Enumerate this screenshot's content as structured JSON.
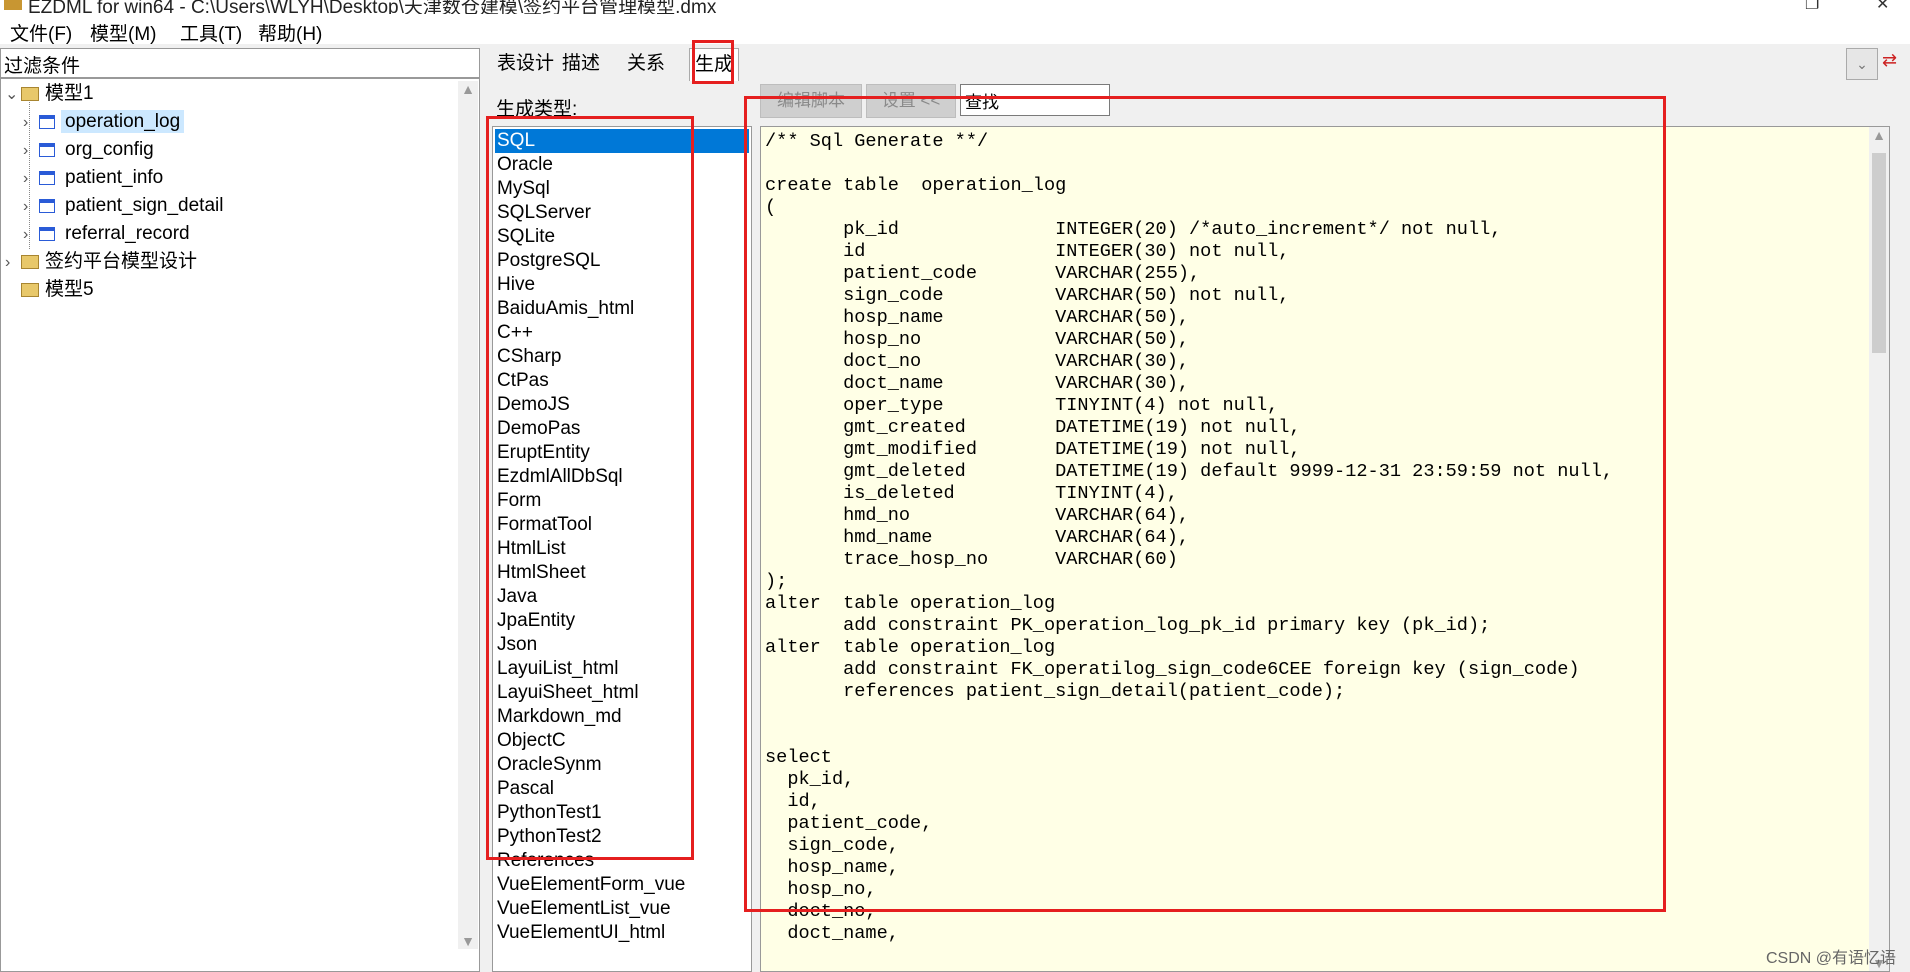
{
  "window": {
    "title": "EZDML for win64 - C:\\Users\\WLYH\\Desktop\\天津数仓建模\\签约平台管理模型.dmx"
  },
  "menu": [
    "文件(F)",
    "模型(M)",
    "工具(T)",
    "帮助(H)"
  ],
  "filter": {
    "label": "过滤条件"
  },
  "tree": {
    "nodes": [
      {
        "label": "模型1",
        "type": "folder",
        "expanded": true
      },
      {
        "label": "operation_log",
        "type": "table",
        "selected": true
      },
      {
        "label": "org_config",
        "type": "table"
      },
      {
        "label": "patient_info",
        "type": "table"
      },
      {
        "label": "patient_sign_detail",
        "type": "table"
      },
      {
        "label": "referral_record",
        "type": "table"
      },
      {
        "label": "签约平台模型设计",
        "type": "folder"
      },
      {
        "label": "模型5",
        "type": "folder"
      }
    ]
  },
  "tabs": [
    "表设计",
    "描述",
    "关系",
    "生成"
  ],
  "active_tab": "生成",
  "gen_type_label": "生成类型:",
  "gen_types": [
    "SQL",
    "Oracle",
    "MySql",
    "SQLServer",
    "SQLite",
    "PostgreSQL",
    "Hive",
    "BaiduAmis_html",
    "C++",
    "CSharp",
    "CtPas",
    "DemoJS",
    "DemoPas",
    "EruptEntity",
    "EzdmlAllDbSql",
    "Form",
    "FormatTool",
    "HtmlList",
    "HtmlSheet",
    "Java",
    "JpaEntity",
    "Json",
    "LayuiList_html",
    "LayuiSheet_html",
    "Markdown_md",
    "ObjectC",
    "OracleSynm",
    "Pascal",
    "PythonTest1",
    "PythonTest2",
    "References",
    "VueElementForm_vue",
    "VueElementList_vue",
    "VueElementUI_html"
  ],
  "selected_type": "SQL",
  "toolbar": {
    "edit_script": "编辑脚本",
    "settings": "设置 <<",
    "search_value": "查找"
  },
  "code": "/** Sql Generate **/\n\ncreate table  operation_log\n(\n       pk_id              INTEGER(20) /*auto_increment*/ not null,\n       id                 INTEGER(30) not null,\n       patient_code       VARCHAR(255),\n       sign_code          VARCHAR(50) not null,\n       hosp_name          VARCHAR(50),\n       hosp_no            VARCHAR(50),\n       doct_no            VARCHAR(30),\n       doct_name          VARCHAR(30),\n       oper_type          TINYINT(4) not null,\n       gmt_created        DATETIME(19) not null,\n       gmt_modified       DATETIME(19) not null,\n       gmt_deleted        DATETIME(19) default 9999-12-31 23:59:59 not null,\n       is_deleted         TINYINT(4),\n       hmd_no             VARCHAR(64),\n       hmd_name           VARCHAR(64),\n       trace_hosp_no      VARCHAR(60)\n);\nalter  table operation_log\n       add constraint PK_operation_log_pk_id primary key (pk_id);\nalter  table operation_log\n       add constraint FK_operatilog_sign_code6CEE foreign key (sign_code)\n       references patient_sign_detail(patient_code);\n\n\nselect\n  pk_id,\n  id,\n  patient_code,\n  sign_code,\n  hosp_name,\n  hosp_no,\n  doct_no,\n  doct_name,",
  "watermark": "CSDN @有语忆语",
  "colors": {
    "highlight": "#e51f1f",
    "selection": "#0078d7",
    "editor_bg": "#ffffe6"
  }
}
